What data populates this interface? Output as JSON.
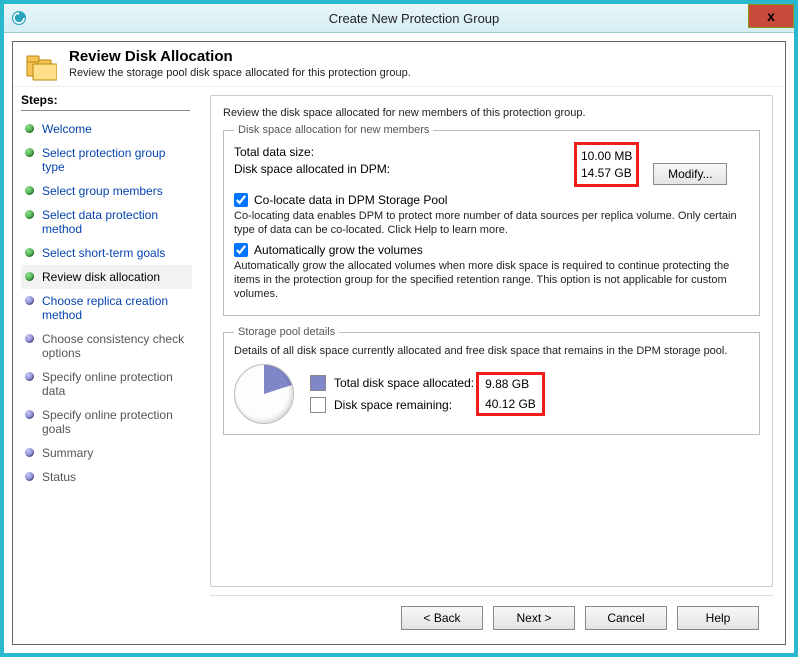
{
  "window": {
    "title": "Create New Protection Group",
    "close": "x"
  },
  "header": {
    "title": "Review Disk Allocation",
    "subtitle": "Review the storage pool disk space allocated for this protection group."
  },
  "steps": {
    "heading": "Steps:",
    "items": [
      {
        "label": "Welcome",
        "state": "done"
      },
      {
        "label": "Select protection group type",
        "state": "done"
      },
      {
        "label": "Select group members",
        "state": "done"
      },
      {
        "label": "Select data protection method",
        "state": "done"
      },
      {
        "label": "Select short-term goals",
        "state": "done"
      },
      {
        "label": "Review disk allocation",
        "state": "current"
      },
      {
        "label": "Choose replica creation method",
        "state": "future-blue"
      },
      {
        "label": "Choose consistency check options",
        "state": "future"
      },
      {
        "label": "Specify online protection data",
        "state": "future"
      },
      {
        "label": "Specify online protection goals",
        "state": "future"
      },
      {
        "label": "Summary",
        "state": "future"
      },
      {
        "label": "Status",
        "state": "future"
      }
    ]
  },
  "content": {
    "intro": "Review the disk space allocated for new members of this protection group.",
    "alloc": {
      "legend": "Disk space allocation for new members",
      "total_label": "Total data size:",
      "total_value": "10.00 MB",
      "dpm_label": "Disk space allocated in DPM:",
      "dpm_value": "14.57 GB",
      "modify": "Modify..."
    },
    "colocate": {
      "label": "Co-locate data in DPM Storage Pool",
      "desc": "Co-locating data enables DPM to protect more number of data sources per replica volume. Only certain type of data can be co-located. Click Help to learn more."
    },
    "autogrow": {
      "label": "Automatically grow the volumes",
      "desc": "Automatically grow the allocated volumes when more disk space is required to continue protecting the items in the protection group for the specified retention range. This option is not applicable for custom volumes."
    },
    "pool": {
      "legend": "Storage pool details",
      "desc": "Details of all disk space currently allocated and free disk space that remains in the DPM storage pool.",
      "alloc_label": "Total disk space allocated:",
      "alloc_value": "9.88 GB",
      "remain_label": "Disk space remaining:",
      "remain_value": "40.12 GB"
    }
  },
  "footer": {
    "back": "< Back",
    "next": "Next >",
    "cancel": "Cancel",
    "help": "Help"
  }
}
